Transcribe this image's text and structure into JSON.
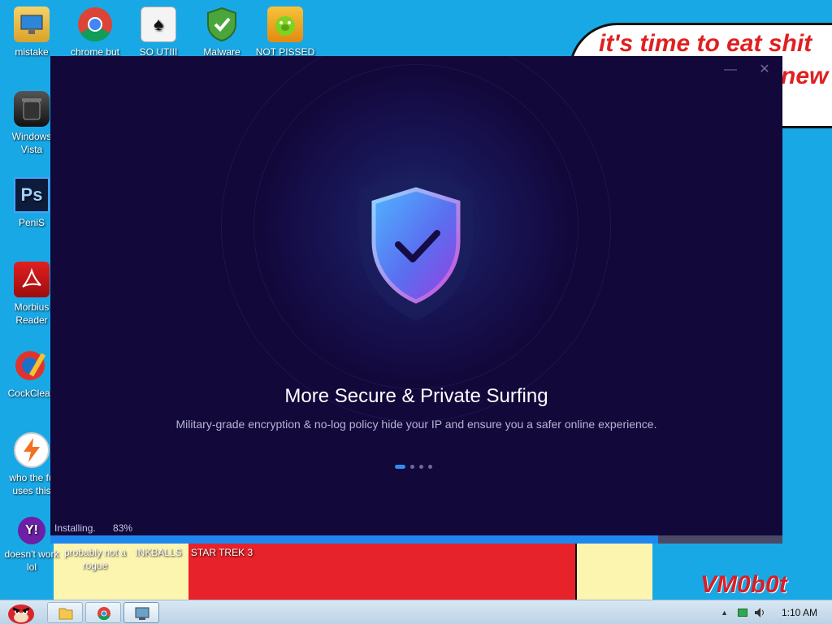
{
  "desktop": {
    "speech_line1": "it's time to eat shit",
    "speech_line2": "new",
    "watermark": "VM0b0t",
    "icons": [
      {
        "label": "mistake",
        "icon": "computer-icon"
      },
      {
        "label": "chrome but",
        "icon": "chrome-icon"
      },
      {
        "label": "SO UTIII",
        "icon": "solitaire-icon"
      },
      {
        "label": "Malware",
        "icon": "shield-check-icon"
      },
      {
        "label": "NOT PISSED",
        "icon": "angry-pig-icon"
      },
      {
        "label": "Windows Vista",
        "icon": "trash-can-icon"
      },
      {
        "label": "PeniS",
        "icon": "photoshop-icon"
      },
      {
        "label": "Morbius Reader",
        "icon": "pdf-reader-icon"
      },
      {
        "label": "CockClean",
        "icon": "cleaner-icon"
      },
      {
        "label": "who the fu uses this",
        "icon": "lightning-icon"
      },
      {
        "label": "doesn't work lol",
        "icon": "yahoo-messenger-icon"
      },
      {
        "label": "probably not a rogue",
        "icon": "program-icon"
      },
      {
        "label": "INKBALLS",
        "icon": "inkball-icon"
      },
      {
        "label": "STAR TREK 3",
        "icon": "star-wars-icon"
      }
    ]
  },
  "installer": {
    "minimize_glyph": "—",
    "close_glyph": "✕",
    "headline": "More Secure & Private Surfing",
    "subline": "Military-grade encryption & no-log policy hide your IP and ensure you a safer online experience.",
    "carousel_active_index": 0,
    "carousel_count": 4,
    "status_label": "Installing.",
    "progress_text": "83%",
    "progress_value": 0.83
  },
  "taskbar": {
    "clock": "1:10 AM",
    "pinned": [
      "folder-icon",
      "chrome-icon",
      "installer-icon"
    ]
  },
  "colors": {
    "desktop_bg": "#19a8e6",
    "installer_bg": "#12083a",
    "accent": "#1e88f0"
  }
}
